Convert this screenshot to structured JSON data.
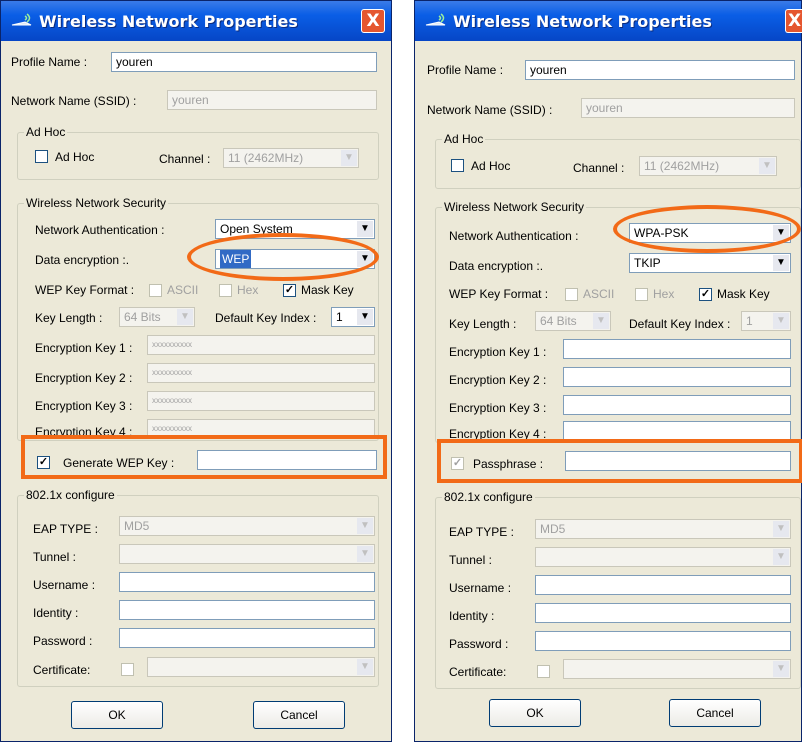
{
  "left": {
    "title": "Wireless Network Properties",
    "close_label": "X",
    "profile_name_label": "Profile Name :",
    "profile_name_value": "youren",
    "ssid_label": "Network Name (SSID) :",
    "ssid_value": "youren",
    "adhoc_group": "Ad Hoc",
    "adhoc_checkbox_label": "Ad Hoc",
    "channel_label": "Channel :",
    "channel_value": "11 (2462MHz)",
    "security_group": "Wireless Network Security",
    "auth_label": "Network Authentication :",
    "auth_value": "Open System",
    "encryption_label": "Data encryption :.",
    "encryption_value": "WEP",
    "wep_format_label": "WEP Key Format :",
    "ascii_label": "ASCII",
    "hex_label": "Hex",
    "mask_key_label": "Mask Key",
    "key_length_label": "Key Length :",
    "key_length_value": "64 Bits",
    "default_key_label": "Default Key Index :",
    "default_key_value": "1",
    "key1_label": "Encryption Key 1 :",
    "key1_value": "xxxxxxxxxx",
    "key2_label": "Encryption Key 2 :",
    "key2_value": "xxxxxxxxxx",
    "key3_label": "Encryption Key 3 :",
    "key3_value": "xxxxxxxxxx",
    "key4_label": "Encryption Key 4 :",
    "key4_value": "xxxxxxxxxx",
    "generate_label": "Generate WEP Key :",
    "dot1x_group": "802.1x configure",
    "eap_label": "EAP TYPE :",
    "eap_value": "MD5",
    "tunnel_label": "Tunnel :",
    "username_label": "Username :",
    "identity_label": "Identity :",
    "password_label": "Password :",
    "certificate_label": "Certificate:",
    "ok_label": "OK",
    "cancel_label": "Cancel"
  },
  "right": {
    "title": "Wireless Network Properties",
    "close_label": "X",
    "profile_name_label": "Profile Name :",
    "profile_name_value": "youren",
    "ssid_label": "Network Name (SSID) :",
    "ssid_value": "youren",
    "adhoc_group": "Ad Hoc",
    "adhoc_checkbox_label": "Ad Hoc",
    "channel_label": "Channel :",
    "channel_value": "11 (2462MHz)",
    "security_group": "Wireless Network Security",
    "auth_label": "Network Authentication :",
    "auth_value": "WPA-PSK",
    "encryption_label": "Data encryption :.",
    "encryption_value": "TKIP",
    "wep_format_label": "WEP Key Format :",
    "ascii_label": "ASCII",
    "hex_label": "Hex",
    "mask_key_label": "Mask Key",
    "key_length_label": "Key Length :",
    "key_length_value": "64 Bits",
    "default_key_label": "Default Key Index :",
    "default_key_value": "1",
    "key1_label": "Encryption Key 1 :",
    "key2_label": "Encryption Key 2 :",
    "key3_label": "Encryption Key 3 :",
    "key4_label": "Encryption Key 4 :",
    "passphrase_label": "Passphrase :",
    "dot1x_group": "802.1x configure",
    "eap_label": "EAP TYPE :",
    "eap_value": "MD5",
    "tunnel_label": "Tunnel :",
    "username_label": "Username :",
    "identity_label": "Identity :",
    "password_label": "Password :",
    "certificate_label": "Certificate:",
    "ok_label": "OK",
    "cancel_label": "Cancel"
  },
  "icons": {
    "title": "wireless-icon",
    "close": "close-icon",
    "dropdown": "chevron-down-icon",
    "check": "checkmark-icon"
  },
  "colors": {
    "highlight": "#f26a17",
    "titlebar": "#0a5ee6",
    "dialog": "#ece9d8"
  }
}
